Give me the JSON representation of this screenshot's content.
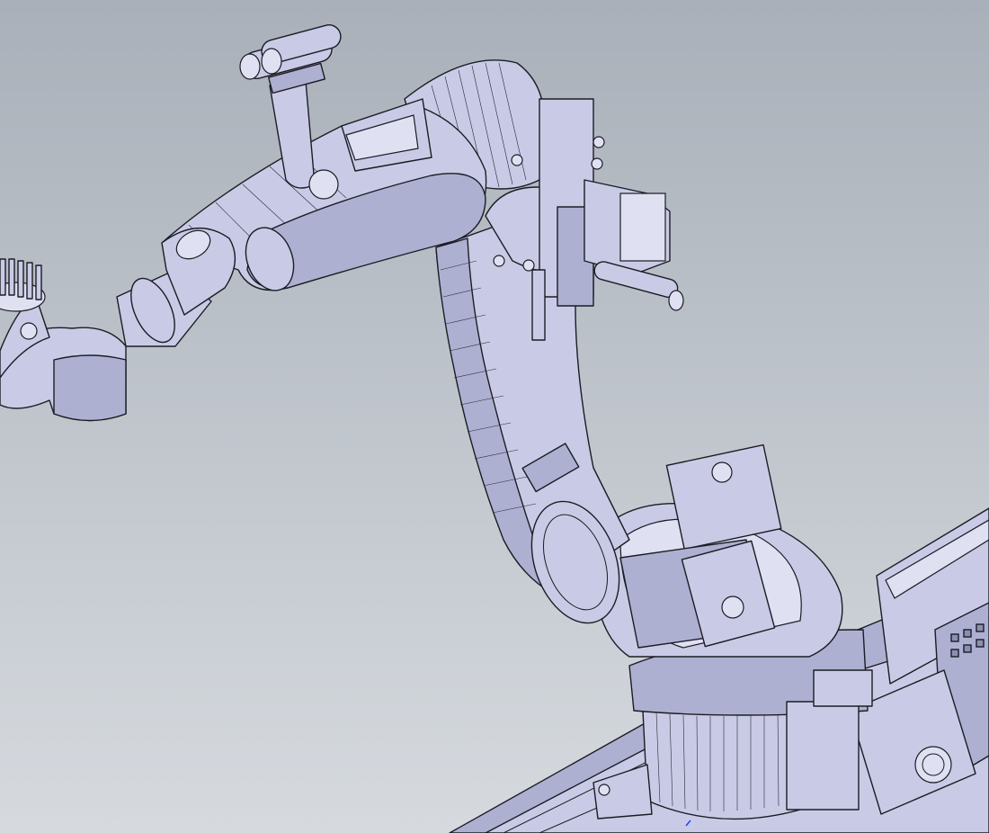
{
  "scene": {
    "subject": "robot-arm-cad-model",
    "render_style": "shaded-with-edges",
    "colors": {
      "background_top": "#a9b0b9",
      "background_bottom": "#d6dadf",
      "part_fill": "#c9cbe6",
      "part_shadow": "#aeb0d2",
      "part_dark": "#8c8eb5",
      "edge": "#1c1c24"
    }
  }
}
